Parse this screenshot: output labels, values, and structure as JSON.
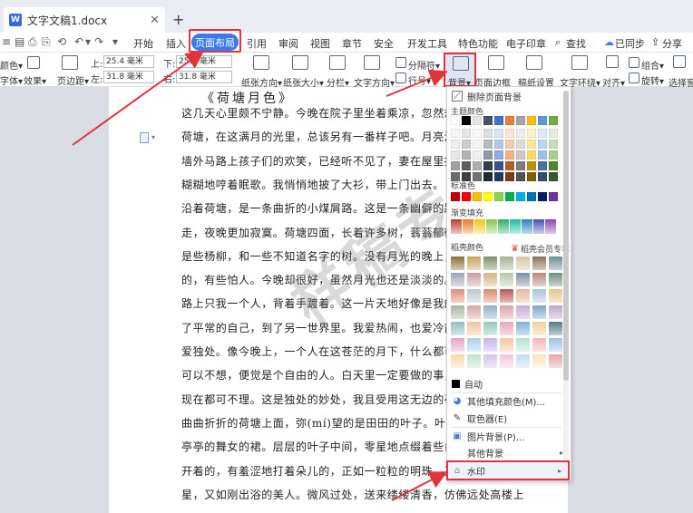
{
  "tab": {
    "icon_label": "W",
    "title": "文字文稿1.docx",
    "close": "✕",
    "new": "+"
  },
  "menu": {
    "quick": [
      "≡",
      "▤",
      "⎙",
      "⎘",
      "⟲",
      "↶",
      "▾",
      "↷",
      "▾"
    ],
    "items": [
      "开始",
      "插入",
      "页面布局",
      "引用",
      "审阅",
      "视图",
      "章节",
      "安全",
      "开发工具",
      "特色功能",
      "电子印章"
    ],
    "search": "查找",
    "sync": "已同步",
    "share": "分享"
  },
  "ribbon": {
    "theme_color": "颜色▾",
    "font": "字体▾",
    "effect": "效果▾",
    "margins": "页边距▾",
    "top_label": "上:",
    "top_value": "25.4 毫米",
    "bottom_label": "下:",
    "bottom_value": "25.4 毫米",
    "left_label": "左:",
    "left_value": "31.8 毫米",
    "right_label": "右:",
    "right_value": "31.8 毫米",
    "orientation": "纸张方向▾",
    "size": "纸张大小▾",
    "columns": "分栏▾",
    "text_direction": "文字方向▾",
    "page_break": "分隔符▾",
    "line_number": "行号▾",
    "background": "背景▾",
    "page_border": "页面边框",
    "paper_setup": "稿纸设置",
    "wrap": "文字环绕▾",
    "align": "对齐▾",
    "group": "组合▾",
    "rotate": "旋转▾",
    "selection_pane": "选择窗"
  },
  "document": {
    "heading": "《荷塘月色》",
    "lines": [
      "这几天心里颇不宁静。今晚在院子里坐着乘凉，忽然想起",
      "荷塘，在这满月的光里，总该另有一番样子吧。月亮渐渐",
      "墙外马路上孩子们的欢笑，已经听不见了，妻在屋里拍着",
      "糊糊地哼着眠歌。我悄悄地披了大衫，带上门出去。",
      "沿着荷塘，是一条曲折的小煤屑路。这是一条幽僻的路；",
      "走，夜晚更加寂寞。荷塘四面，长着许多树，蓊蓊郁郁的",
      "是些杨柳，和一些不知道名字的树。没有月光的晚上，这",
      "的，有些怕人。今晚却很好，虽然月光也还是淡淡的。",
      "路上只我一个人，背着手踱着。这一片天地好像是我的；",
      "了平常的自己，到了另一世界里。我爱热闹，也爱冷静；",
      "爱独处。像今晚上，一个人在这苍茫的月下，什么都可以",
      "可以不想，便觉是个自由的人。白天里一定要做的事，一",
      "现在都可不理。这是独处的妙处，我且受用这无边的荷香",
      "曲曲折折的荷塘上面，弥(mí)望的是田田的叶子。叶子出",
      "亭亭的舞女的裙。层层的叶子中间，零星地点缀着些白花",
      "开着的，有羞涩地打着朵儿的，正如一粒粒的明珠，又如",
      "星，又如刚出浴的美人。微风过处，送来缕缕清香，仿佛远处高楼上"
    ]
  },
  "watermark": "样稿专用",
  "dropdown": {
    "remove_bg": "删除页面背景",
    "theme_colors": "主题颜色",
    "standard_colors": "标准色",
    "gradient_fill": "渐变填充",
    "shell_colors": "稻壳颜色",
    "member_share": "稻壳会员专享",
    "auto": "自动",
    "more_fill": "其他填充颜色(M)...",
    "picker": "取色器(E)",
    "picture_bg": "图片背景(P)...",
    "other_bg": "其他背景",
    "watermark": "水印",
    "theme_row1": [
      "#ffffff",
      "#000000",
      "#e7e6e6",
      "#44546a",
      "#4472c4",
      "#ed7d31",
      "#a5a5a5",
      "#ffc000",
      "#5b9bd5",
      "#70ad47"
    ],
    "standard": [
      "#c00000",
      "#ff0000",
      "#ffc000",
      "#ffff00",
      "#92d050",
      "#00b050",
      "#00b0f0",
      "#0070c0",
      "#002060",
      "#7030a0"
    ],
    "gradients": [
      "#c0392b",
      "#e67e22",
      "#f1c40f",
      "#8bc34a",
      "#27ae60",
      "#1abc9c",
      "#2980b9",
      "#3f51b5",
      "#8e44ad"
    ],
    "palette": [
      "#8a6d3b",
      "#c9a25b",
      "#7f8c6a",
      "#a8b09a",
      "#d8c7a3",
      "#8e6e5b",
      "#6b8e8e",
      "#9aa5b8",
      "#c79fa0",
      "#d4b483",
      "#b8c7b0",
      "#7d8fa6",
      "#b98a7a",
      "#6f8f7f",
      "#e08a7a",
      "#b8c6d6",
      "#d98c6b",
      "#c0504d",
      "#e8b49a",
      "#a9c4de",
      "#e6c48a",
      "#a3b8a0",
      "#d6a6a6",
      "#8fb0c9",
      "#e2a0a0",
      "#c9a9d6",
      "#7fa7c8",
      "#bfa6c9",
      "#8fc1c1",
      "#f2c29b",
      "#93c9b6",
      "#e8a6b9",
      "#7bb2d9",
      "#f0d19b",
      "#4f7c8a",
      "#e9a3c9",
      "#a7d3e8",
      "#c6b5e6",
      "#f5c6a5",
      "#b9e0d0",
      "#f3b6b6",
      "#9ac5e5",
      "#f7d8a8",
      "#bde3c8",
      "#d5c4ec",
      "#f1c8d8",
      "#c4dcf0",
      "#fbe3b9",
      "#e4a7a7"
    ]
  }
}
